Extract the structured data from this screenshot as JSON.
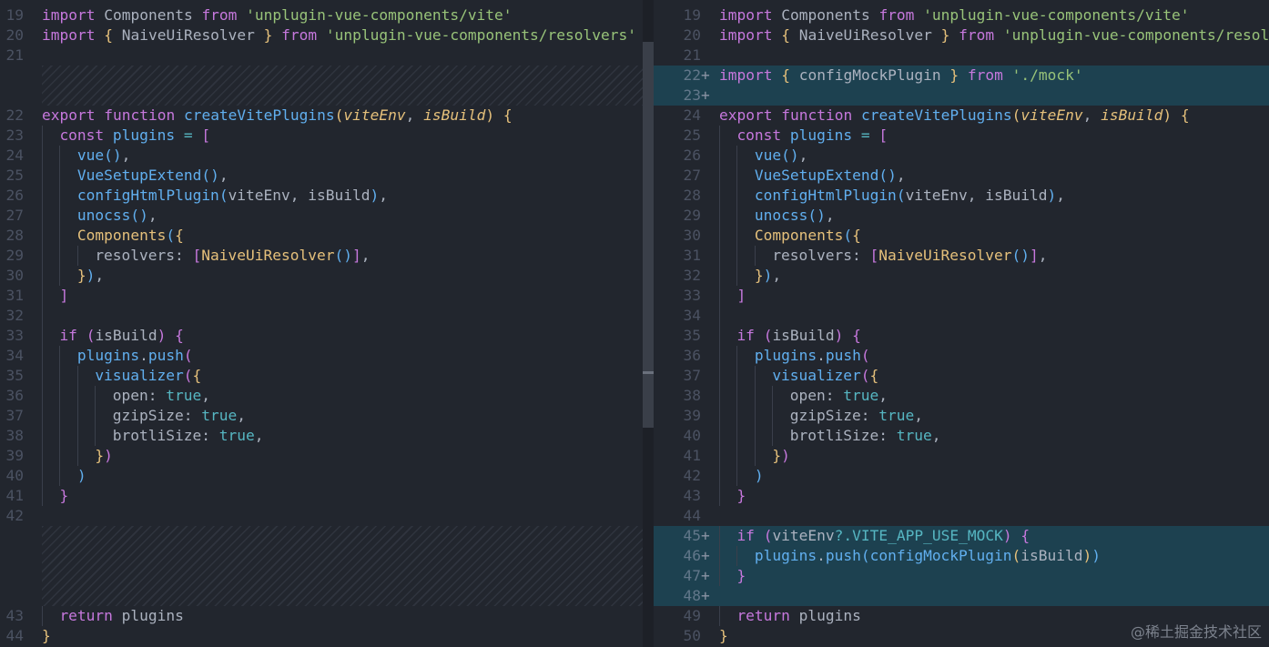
{
  "left_pane": {
    "lines": [
      {
        "n": "19",
        "tokens": [
          [
            "k",
            "import"
          ],
          [
            "t",
            " Components "
          ],
          [
            "k",
            "from"
          ],
          [
            "t",
            " "
          ],
          [
            "s",
            "'unplugin-vue-components/vite'"
          ]
        ]
      },
      {
        "n": "20",
        "tokens": [
          [
            "k",
            "import"
          ],
          [
            "t",
            " "
          ],
          [
            "b",
            "{"
          ],
          [
            "t",
            " NaiveUiResolver "
          ],
          [
            "b",
            "}"
          ],
          [
            "t",
            " "
          ],
          [
            "k",
            "from"
          ],
          [
            "t",
            " "
          ],
          [
            "s",
            "'unplugin-vue-components/resolvers'"
          ]
        ]
      },
      {
        "n": "21",
        "tokens": []
      },
      {
        "filler": 2
      },
      {
        "n": "22",
        "tokens": [
          [
            "k",
            "export"
          ],
          [
            "t",
            " "
          ],
          [
            "k",
            "function"
          ],
          [
            "t",
            " "
          ],
          [
            "f",
            "createVitePlugins"
          ],
          [
            "b",
            "("
          ],
          [
            "i",
            "viteEnv"
          ],
          [
            "t",
            ", "
          ],
          [
            "i",
            "isBuild"
          ],
          [
            "b",
            ")"
          ],
          [
            "t",
            " "
          ],
          [
            "b",
            "{"
          ]
        ]
      },
      {
        "n": "23",
        "indent": 1,
        "tokens": [
          [
            "k",
            "const"
          ],
          [
            "t",
            " "
          ],
          [
            "f",
            "plugins"
          ],
          [
            "t",
            " "
          ],
          [
            "c",
            "="
          ],
          [
            "t",
            " "
          ],
          [
            "bm",
            "["
          ]
        ]
      },
      {
        "n": "24",
        "indent": 2,
        "tokens": [
          [
            "f",
            "vue"
          ],
          [
            "bb",
            "()"
          ],
          [
            "t",
            ","
          ]
        ]
      },
      {
        "n": "25",
        "indent": 2,
        "tokens": [
          [
            "f",
            "VueSetupExtend"
          ],
          [
            "bb",
            "()"
          ],
          [
            "t",
            ","
          ]
        ]
      },
      {
        "n": "26",
        "indent": 2,
        "tokens": [
          [
            "f",
            "configHtmlPlugin"
          ],
          [
            "bb",
            "("
          ],
          [
            "t",
            "viteEnv, isBuild"
          ],
          [
            "bb",
            ")"
          ],
          [
            "t",
            ","
          ]
        ]
      },
      {
        "n": "27",
        "indent": 2,
        "tokens": [
          [
            "f",
            "unocss"
          ],
          [
            "bb",
            "()"
          ],
          [
            "t",
            ","
          ]
        ]
      },
      {
        "n": "28",
        "indent": 2,
        "tokens": [
          [
            "p",
            "Components"
          ],
          [
            "bb",
            "("
          ],
          [
            "b",
            "{"
          ]
        ]
      },
      {
        "n": "29",
        "indent": 3,
        "tokens": [
          [
            "t",
            "resolvers: "
          ],
          [
            "bm",
            "["
          ],
          [
            "p",
            "NaiveUiResolver"
          ],
          [
            "bb",
            "()"
          ],
          [
            "bm",
            "]"
          ],
          [
            "t",
            ","
          ]
        ]
      },
      {
        "n": "30",
        "indent": 2,
        "tokens": [
          [
            "b",
            "}"
          ],
          [
            "bb",
            ")"
          ],
          [
            "t",
            ","
          ]
        ]
      },
      {
        "n": "31",
        "indent": 1,
        "tokens": [
          [
            "bm",
            "]"
          ]
        ]
      },
      {
        "n": "32",
        "indent": 1,
        "tokens": []
      },
      {
        "n": "33",
        "indent": 1,
        "tokens": [
          [
            "k",
            "if"
          ],
          [
            "t",
            " "
          ],
          [
            "bm",
            "("
          ],
          [
            "t",
            "isBuild"
          ],
          [
            "bm",
            ")"
          ],
          [
            "t",
            " "
          ],
          [
            "bm",
            "{"
          ]
        ]
      },
      {
        "n": "34",
        "indent": 2,
        "tokens": [
          [
            "f",
            "plugins"
          ],
          [
            "t",
            "."
          ],
          [
            "f",
            "push"
          ],
          [
            "bm",
            "("
          ]
        ]
      },
      {
        "n": "35",
        "indent": 3,
        "tokens": [
          [
            "f",
            "visualizer"
          ],
          [
            "bm",
            "("
          ],
          [
            "b",
            "{"
          ]
        ]
      },
      {
        "n": "36",
        "indent": 4,
        "tokens": [
          [
            "t",
            "open: "
          ],
          [
            "c",
            "true"
          ],
          [
            "t",
            ","
          ]
        ]
      },
      {
        "n": "37",
        "indent": 4,
        "tokens": [
          [
            "t",
            "gzipSize: "
          ],
          [
            "c",
            "true"
          ],
          [
            "t",
            ","
          ]
        ]
      },
      {
        "n": "38",
        "indent": 4,
        "tokens": [
          [
            "t",
            "brotliSize: "
          ],
          [
            "c",
            "true"
          ],
          [
            "t",
            ","
          ]
        ]
      },
      {
        "n": "39",
        "indent": 3,
        "tokens": [
          [
            "b",
            "}"
          ],
          [
            "bm",
            ")"
          ]
        ]
      },
      {
        "n": "40",
        "indent": 2,
        "tokens": [
          [
            "bb",
            ")"
          ]
        ]
      },
      {
        "n": "41",
        "indent": 1,
        "tokens": [
          [
            "bm",
            "}"
          ]
        ]
      },
      {
        "n": "42",
        "tokens": []
      },
      {
        "filler": 4
      },
      {
        "n": "43",
        "indent": 1,
        "tokens": [
          [
            "k",
            "return"
          ],
          [
            "t",
            " plugins"
          ]
        ]
      },
      {
        "n": "44",
        "tokens": [
          [
            "b",
            "}"
          ]
        ]
      }
    ]
  },
  "right_pane": {
    "lines": [
      {
        "n": "19",
        "tokens": [
          [
            "k",
            "import"
          ],
          [
            "t",
            " Components "
          ],
          [
            "k",
            "from"
          ],
          [
            "t",
            " "
          ],
          [
            "s",
            "'unplugin-vue-components/vite'"
          ]
        ]
      },
      {
        "n": "20",
        "tokens": [
          [
            "k",
            "import"
          ],
          [
            "t",
            " "
          ],
          [
            "b",
            "{"
          ],
          [
            "t",
            " NaiveUiResolver "
          ],
          [
            "b",
            "}"
          ],
          [
            "t",
            " "
          ],
          [
            "k",
            "from"
          ],
          [
            "t",
            " "
          ],
          [
            "s",
            "'unplugin-vue-components/resolvers'"
          ]
        ]
      },
      {
        "n": "21",
        "tokens": []
      },
      {
        "n": "22",
        "added": true,
        "tokens": [
          [
            "k",
            "import"
          ],
          [
            "t",
            " "
          ],
          [
            "b",
            "{"
          ],
          [
            "t",
            " configMockPlugin "
          ],
          [
            "b",
            "}"
          ],
          [
            "t",
            " "
          ],
          [
            "k",
            "from"
          ],
          [
            "t",
            " "
          ],
          [
            "s",
            "'./mock'"
          ]
        ]
      },
      {
        "n": "23",
        "added": true,
        "tokens": []
      },
      {
        "n": "24",
        "tokens": [
          [
            "k",
            "export"
          ],
          [
            "t",
            " "
          ],
          [
            "k",
            "function"
          ],
          [
            "t",
            " "
          ],
          [
            "f",
            "createVitePlugins"
          ],
          [
            "b",
            "("
          ],
          [
            "i",
            "viteEnv"
          ],
          [
            "t",
            ", "
          ],
          [
            "i",
            "isBuild"
          ],
          [
            "b",
            ")"
          ],
          [
            "t",
            " "
          ],
          [
            "b",
            "{"
          ]
        ]
      },
      {
        "n": "25",
        "indent": 1,
        "tokens": [
          [
            "k",
            "const"
          ],
          [
            "t",
            " "
          ],
          [
            "f",
            "plugins"
          ],
          [
            "t",
            " "
          ],
          [
            "c",
            "="
          ],
          [
            "t",
            " "
          ],
          [
            "bm",
            "["
          ]
        ]
      },
      {
        "n": "26",
        "indent": 2,
        "tokens": [
          [
            "f",
            "vue"
          ],
          [
            "bb",
            "()"
          ],
          [
            "t",
            ","
          ]
        ]
      },
      {
        "n": "27",
        "indent": 2,
        "tokens": [
          [
            "f",
            "VueSetupExtend"
          ],
          [
            "bb",
            "()"
          ],
          [
            "t",
            ","
          ]
        ]
      },
      {
        "n": "28",
        "indent": 2,
        "tokens": [
          [
            "f",
            "configHtmlPlugin"
          ],
          [
            "bb",
            "("
          ],
          [
            "t",
            "viteEnv, isBuild"
          ],
          [
            "bb",
            ")"
          ],
          [
            "t",
            ","
          ]
        ]
      },
      {
        "n": "29",
        "indent": 2,
        "tokens": [
          [
            "f",
            "unocss"
          ],
          [
            "bb",
            "()"
          ],
          [
            "t",
            ","
          ]
        ]
      },
      {
        "n": "30",
        "indent": 2,
        "tokens": [
          [
            "p",
            "Components"
          ],
          [
            "bb",
            "("
          ],
          [
            "b",
            "{"
          ]
        ]
      },
      {
        "n": "31",
        "indent": 3,
        "tokens": [
          [
            "t",
            "resolvers: "
          ],
          [
            "bm",
            "["
          ],
          [
            "p",
            "NaiveUiResolver"
          ],
          [
            "bb",
            "()"
          ],
          [
            "bm",
            "]"
          ],
          [
            "t",
            ","
          ]
        ]
      },
      {
        "n": "32",
        "indent": 2,
        "tokens": [
          [
            "b",
            "}"
          ],
          [
            "bb",
            ")"
          ],
          [
            "t",
            ","
          ]
        ]
      },
      {
        "n": "33",
        "indent": 1,
        "tokens": [
          [
            "bm",
            "]"
          ]
        ]
      },
      {
        "n": "34",
        "indent": 1,
        "tokens": []
      },
      {
        "n": "35",
        "indent": 1,
        "tokens": [
          [
            "k",
            "if"
          ],
          [
            "t",
            " "
          ],
          [
            "bm",
            "("
          ],
          [
            "t",
            "isBuild"
          ],
          [
            "bm",
            ")"
          ],
          [
            "t",
            " "
          ],
          [
            "bm",
            "{"
          ]
        ]
      },
      {
        "n": "36",
        "indent": 2,
        "tokens": [
          [
            "f",
            "plugins"
          ],
          [
            "t",
            "."
          ],
          [
            "f",
            "push"
          ],
          [
            "bm",
            "("
          ]
        ]
      },
      {
        "n": "37",
        "indent": 3,
        "tokens": [
          [
            "f",
            "visualizer"
          ],
          [
            "bm",
            "("
          ],
          [
            "b",
            "{"
          ]
        ]
      },
      {
        "n": "38",
        "indent": 4,
        "tokens": [
          [
            "t",
            "open: "
          ],
          [
            "c",
            "true"
          ],
          [
            "t",
            ","
          ]
        ]
      },
      {
        "n": "39",
        "indent": 4,
        "tokens": [
          [
            "t",
            "gzipSize: "
          ],
          [
            "c",
            "true"
          ],
          [
            "t",
            ","
          ]
        ]
      },
      {
        "n": "40",
        "indent": 4,
        "tokens": [
          [
            "t",
            "brotliSize: "
          ],
          [
            "c",
            "true"
          ],
          [
            "t",
            ","
          ]
        ]
      },
      {
        "n": "41",
        "indent": 3,
        "tokens": [
          [
            "b",
            "}"
          ],
          [
            "bm",
            ")"
          ]
        ]
      },
      {
        "n": "42",
        "indent": 2,
        "tokens": [
          [
            "bb",
            ")"
          ]
        ]
      },
      {
        "n": "43",
        "indent": 1,
        "tokens": [
          [
            "bm",
            "}"
          ]
        ]
      },
      {
        "n": "44",
        "tokens": []
      },
      {
        "n": "45",
        "added": true,
        "indent": 1,
        "tokens": [
          [
            "k",
            "if"
          ],
          [
            "t",
            " "
          ],
          [
            "bm",
            "("
          ],
          [
            "t",
            "viteEnv"
          ],
          [
            "c",
            "?."
          ],
          [
            "c",
            "VITE_APP_USE_MOCK"
          ],
          [
            "bm",
            ")"
          ],
          [
            "t",
            " "
          ],
          [
            "bm",
            "{"
          ]
        ]
      },
      {
        "n": "46",
        "added": true,
        "indent": 2,
        "tokens": [
          [
            "f",
            "plugins"
          ],
          [
            "t",
            "."
          ],
          [
            "f",
            "push"
          ],
          [
            "bb",
            "("
          ],
          [
            "f",
            "configMockPlugin"
          ],
          [
            "b",
            "("
          ],
          [
            "t",
            "isBuild"
          ],
          [
            "b",
            ")"
          ],
          [
            "bb",
            ")"
          ]
        ]
      },
      {
        "n": "47",
        "added": true,
        "indent": 1,
        "tokens": [
          [
            "bm",
            "}"
          ]
        ]
      },
      {
        "n": "48",
        "added": true,
        "tokens": []
      },
      {
        "n": "49",
        "indent": 1,
        "tokens": [
          [
            "k",
            "return"
          ],
          [
            "t",
            " plugins"
          ]
        ]
      },
      {
        "n": "50",
        "tokens": [
          [
            "b",
            "}"
          ]
        ]
      }
    ]
  },
  "added_marker": "+",
  "watermark": "@稀土掘金技术社区",
  "colors": {
    "background": "#22262e",
    "added_line": "#1d4150",
    "keyword": "#c678dd",
    "string": "#98c379",
    "function": "#61afef",
    "param": "#e5c07b",
    "constant": "#56b6c2"
  }
}
